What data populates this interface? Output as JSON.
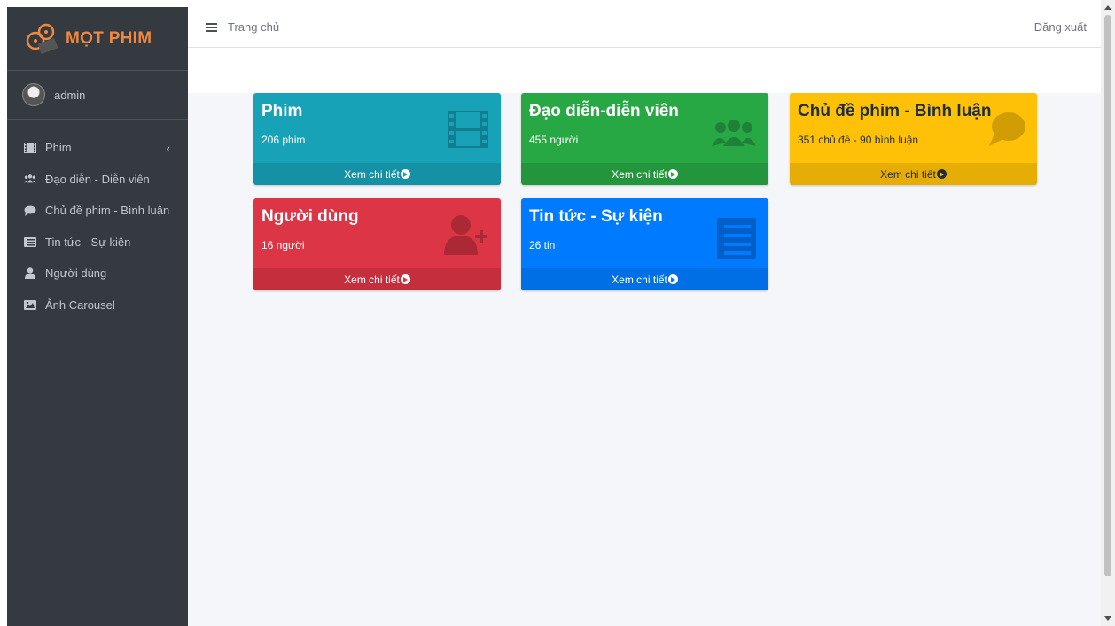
{
  "brand": {
    "name": "MỌT PHIM"
  },
  "user": {
    "name": "admin"
  },
  "sidebar": {
    "items": [
      {
        "label": "Phim",
        "icon": "film-icon"
      },
      {
        "label": "Đạo diễn - Diễn viên",
        "icon": "users-icon"
      },
      {
        "label": "Chủ đề phim - Bình luận",
        "icon": "comment-icon"
      },
      {
        "label": "Tin tức - Sự kiện",
        "icon": "newspaper-icon"
      },
      {
        "label": "Người dùng",
        "icon": "user-icon"
      },
      {
        "label": "Ảnh Carousel",
        "icon": "image-icon"
      }
    ]
  },
  "topbar": {
    "breadcrumb": "Trang chủ",
    "logout": "Đăng xuất"
  },
  "cards": [
    {
      "title": "Phim",
      "subtitle": "206 phim",
      "footer": "Xem chi tiết",
      "color": "#17a2b8",
      "icon": "film-icon"
    },
    {
      "title": "Đạo diễn-diễn viên",
      "subtitle": "455 người",
      "footer": "Xem chi tiết",
      "color": "#28a745",
      "icon": "users-icon"
    },
    {
      "title": "Chủ đề phim - Bình luận",
      "subtitle": "351 chủ đề - 90 bình luận",
      "footer": "Xem chi tiết",
      "color": "#ffc107",
      "icon": "comments-icon"
    },
    {
      "title": "Người dùng",
      "subtitle": "16 người",
      "footer": "Xem chi tiết",
      "color": "#dc3545",
      "icon": "user-plus-icon"
    },
    {
      "title": "Tin tức - Sự kiện",
      "subtitle": "26 tin",
      "footer": "Xem chi tiết",
      "color": "#007bff",
      "icon": "newspaper-icon"
    }
  ]
}
